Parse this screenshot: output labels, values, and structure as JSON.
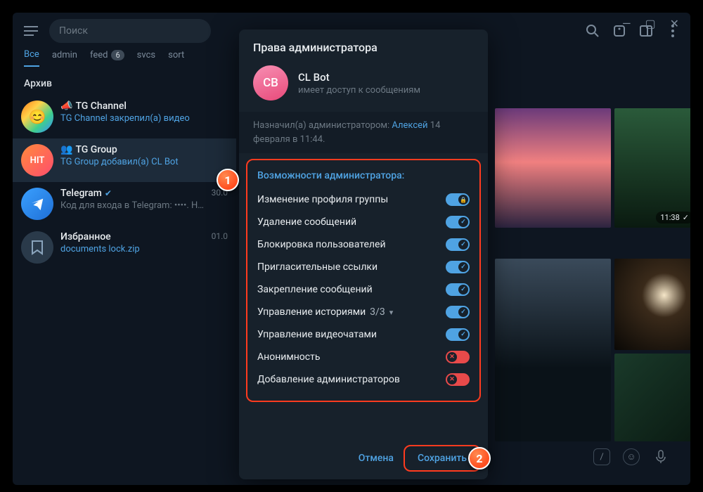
{
  "window_controls": {
    "min": "—",
    "max": "▢",
    "close": "✕"
  },
  "toolbar": {
    "search_placeholder": "Поиск",
    "icons": [
      "search",
      "stories",
      "sidebar",
      "more"
    ]
  },
  "tabs": [
    {
      "label": "Все",
      "active": true
    },
    {
      "label": "admin"
    },
    {
      "label": "feed",
      "badge": "6"
    },
    {
      "label": "svcs"
    },
    {
      "label": "sort"
    }
  ],
  "archive_label": "Архив",
  "chats": [
    {
      "avatar_bg": "linear-gradient(135deg,#ff7a18,#ffd24a,#3ecf8e,#3a8dff)",
      "avatar_text": "",
      "title_prefix": "📣 ",
      "title": "TG Channel",
      "subtitle": "TG Channel закрепил(а) видео",
      "sub_color": "link"
    },
    {
      "avatar_bg": "linear-gradient(135deg,#ff8a3c,#ff4d6d)",
      "avatar_text": "HIT",
      "title_prefix": "👥 ",
      "title": "TG Group",
      "subtitle": "TG Group добавил(а) CL Bot",
      "sub_color": "link",
      "selected": true
    },
    {
      "avatar_bg": "linear-gradient(135deg,#3aa0ff,#1f6fd6)",
      "avatar_text": "",
      "avatar_icon": "plane",
      "title": "Telegram",
      "verified": true,
      "time": "30.0",
      "subtitle": "Код для входа в Telegram: ••••. Не д",
      "sub_color": "grey"
    },
    {
      "avatar_bg": "#2a3a4a",
      "avatar_icon": "bookmark",
      "title": "Избранное",
      "time": "01.0",
      "subtitle": "documents lock.zip",
      "sub_color": "link"
    }
  ],
  "gallery_time": "11:38",
  "modal": {
    "title": "Права администратора",
    "avatar_initials": "CB",
    "name": "CL Bot",
    "status": "имеет доступ к сообщениям",
    "appointed_prefix": "Назначил(а) администратором: ",
    "appointed_user": "Алексей",
    "appointed_suffix": " 14 февраля в 11:44.",
    "section_header": "Возможности администратора:",
    "perms": [
      {
        "label": "Изменение профиля группы",
        "on": true,
        "locked": true
      },
      {
        "label": "Удаление сообщений",
        "on": true
      },
      {
        "label": "Блокировка пользователей",
        "on": true
      },
      {
        "label": "Пригласительные ссылки",
        "on": true
      },
      {
        "label": "Закрепление сообщений",
        "on": true
      },
      {
        "label": "Управление историями",
        "count": "3/3",
        "expandable": true,
        "on": true
      },
      {
        "label": "Управление видеочатами",
        "on": true
      },
      {
        "label": "Анонимность",
        "on": false
      },
      {
        "label": "Добавление администраторов",
        "on": false
      }
    ],
    "cancel": "Отмена",
    "save": "Сохранить"
  },
  "callouts": {
    "one": "1",
    "two": "2"
  }
}
